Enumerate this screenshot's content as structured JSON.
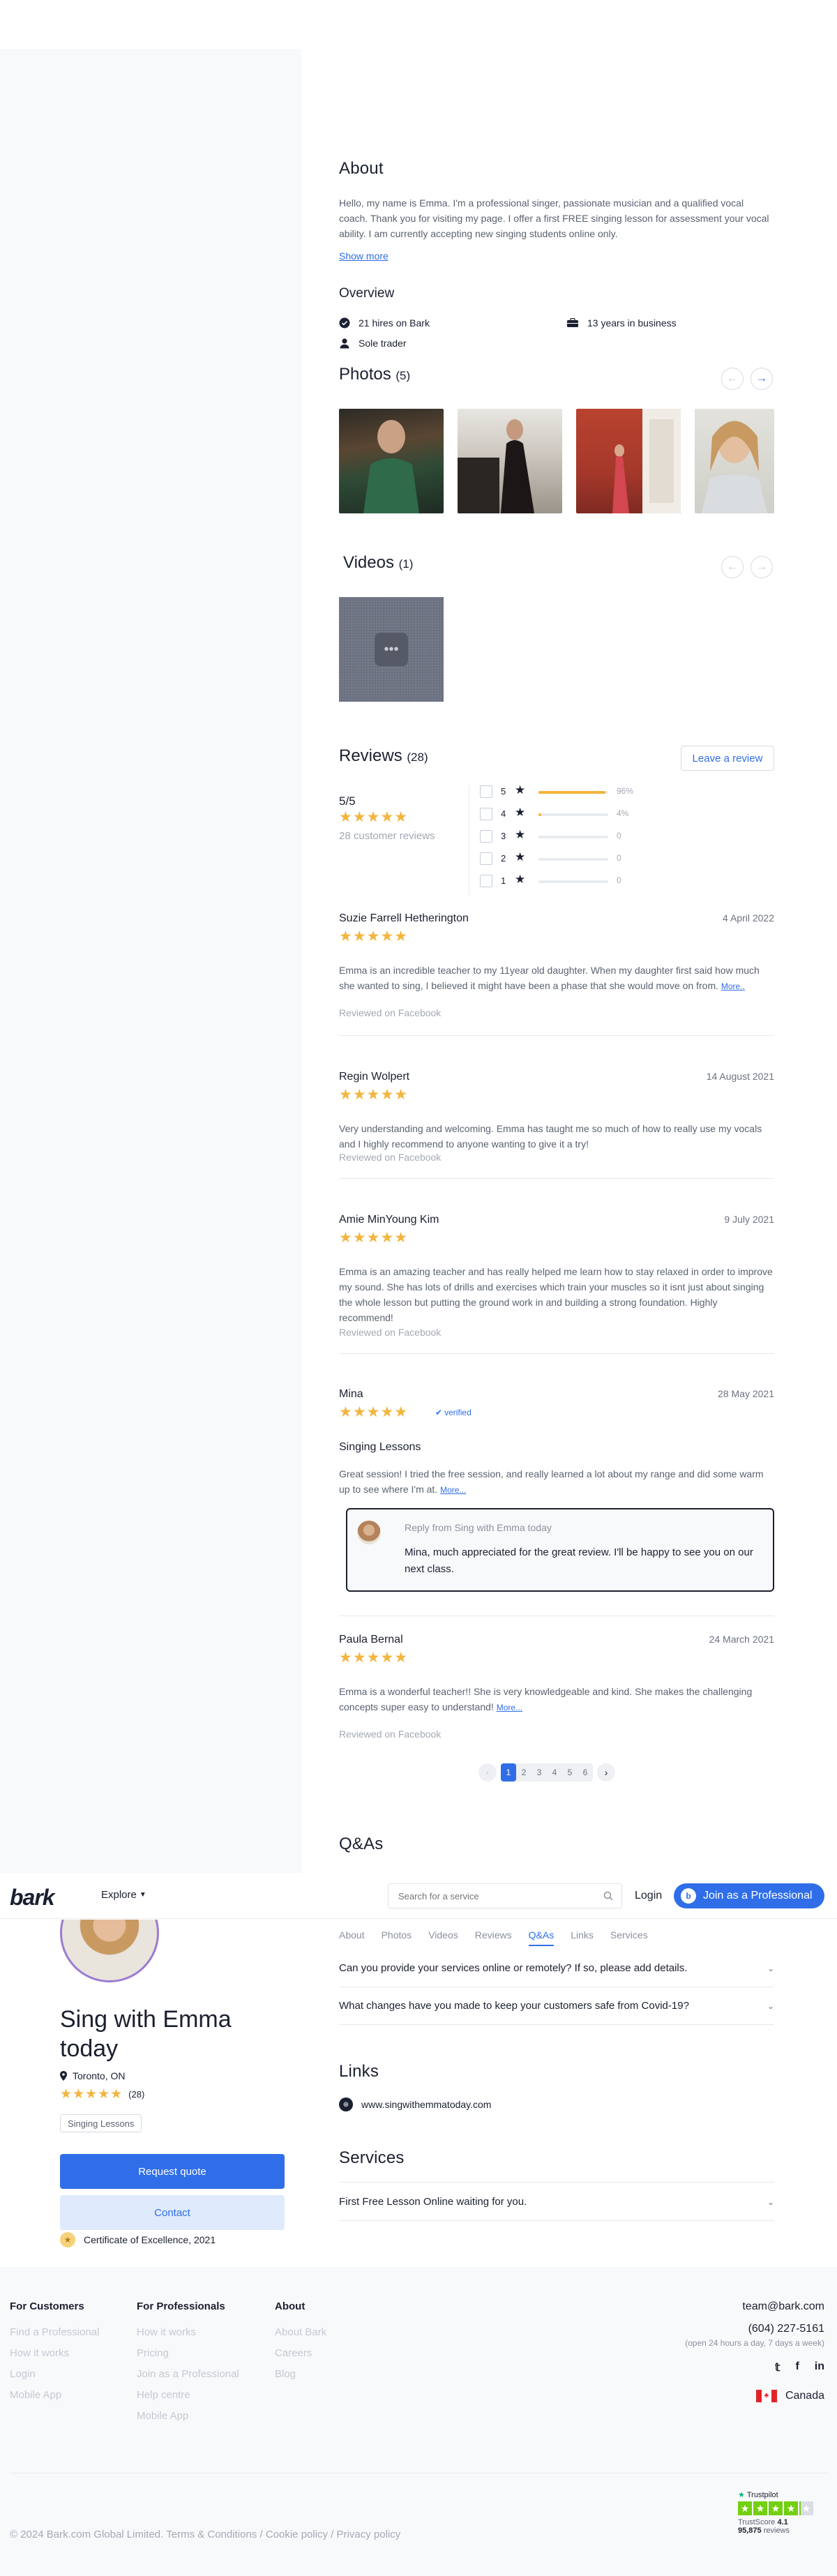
{
  "about": {
    "title": "About",
    "text": "Hello, my name is Emma. I'm a professional singer, passionate musician and a qualified vocal coach. Thank you for visiting my page. I offer a first FREE singing lesson for assessment your vocal ability. I am currently accepting new singing students online only.",
    "show_more": "Show more"
  },
  "overview": {
    "title": "Overview",
    "hires": "21 hires on Bark",
    "years": "13 years in business",
    "trader": "Sole trader"
  },
  "photos": {
    "title": "Photos",
    "count": "(5)"
  },
  "videos": {
    "title": "Videos",
    "count": "(1)"
  },
  "reviews_section": {
    "title": "Reviews",
    "count": "(28)",
    "leave_review": "Leave a review",
    "score": "5/5",
    "customer_reviews": "28 customer reviews",
    "breakdown": [
      {
        "star": "5",
        "pct": "96%",
        "fraction": 0.96
      },
      {
        "star": "4",
        "pct": "4%",
        "fraction": 0.04
      },
      {
        "star": "3",
        "pct": "0",
        "fraction": 0
      },
      {
        "star": "2",
        "pct": "0",
        "fraction": 0
      },
      {
        "star": "1",
        "pct": "0",
        "fraction": 0
      }
    ]
  },
  "reviews": [
    {
      "name": "Suzie Farrell Hetherington",
      "date": "4 April 2022",
      "text": "Emma is an incredible teacher to my 11year old daughter. When my daughter first said how much she wanted to sing, I believed it might have been a phase that she would move on from.",
      "more": "More..",
      "source": "Reviewed on Facebook"
    },
    {
      "name": "Regin Wolpert",
      "date": "14 August 2021",
      "text": "Very understanding and welcoming. Emma has taught me so much of how to really use my vocals and I highly recommend to anyone wanting to give it a try!",
      "source": "Reviewed on Facebook"
    },
    {
      "name": "Amie MinYoung Kim",
      "date": "9 July 2021",
      "text": "Emma is an amazing teacher and has really helped me learn how to stay relaxed in order to improve my sound. She has lots of drills and exercises which train your muscles so it isnt just about singing the whole lesson but putting the ground work in and building a strong foundation. Highly recommend!",
      "source": "Reviewed on Facebook"
    },
    {
      "name": "Mina",
      "date": "28 May 2021",
      "verified": "verified",
      "service": "Singing Lessons",
      "text": "Great session! I tried the free session, and really learned a lot about my range and did some warm up to see where I'm at.",
      "more": "More...",
      "reply_title": "Reply from Sing with Emma today",
      "reply_text": "Mina, much appreciated for the great review. I'll be happy to see you on our next class."
    },
    {
      "name": "Paula Bernal",
      "date": "24 March 2021",
      "text": "Emma is a wonderful teacher!! She is very knowledgeable and kind. She makes the challenging concepts super easy to understand!",
      "more": "More...",
      "source": "Reviewed on Facebook"
    }
  ],
  "pagination": {
    "pages": [
      "1",
      "2",
      "3",
      "4",
      "5",
      "6"
    ],
    "current": "1"
  },
  "qas": {
    "title": "Q&As",
    "questions": [
      "Can you provide your services online or remotely? If so, please add details.",
      "What changes have you made to keep your customers safe from Covid-19?"
    ]
  },
  "header": {
    "logo": "bark",
    "explore": "Explore",
    "search_placeholder": "Search for a service",
    "login": "Login",
    "join": "Join as a Professional"
  },
  "subnav": [
    "About",
    "Photos",
    "Videos",
    "Reviews",
    "Q&As",
    "Links",
    "Services"
  ],
  "subnav_active": "Q&As",
  "profile": {
    "name_line1": "Sing with Emma",
    "name_line2": "today",
    "location": "Toronto, ON",
    "rating_count": "(28)",
    "tag": "Singing Lessons",
    "request_quote": "Request quote",
    "contact": "Contact",
    "certificate": "Certificate of Excellence, 2021"
  },
  "links": {
    "title": "Links",
    "url": "www.singwithemmatoday.com"
  },
  "services": {
    "title": "Services",
    "item": "First Free Lesson Online waiting for you."
  },
  "footer": {
    "customers": {
      "title": "For Customers",
      "items": [
        "Find a Professional",
        "How it works",
        "Login",
        "Mobile App"
      ]
    },
    "professionals": {
      "title": "For Professionals",
      "items": [
        "How it works",
        "Pricing",
        "Join as a Professional",
        "Help centre",
        "Mobile App"
      ]
    },
    "about": {
      "title": "About",
      "items": [
        "About Bark",
        "Careers",
        "Blog"
      ]
    },
    "email": "team@bark.com",
    "phone": "(604) 227-5161",
    "hours": "(open 24 hours a day, 7 days a week)",
    "country": "Canada",
    "copyright": "© 2024 Bark.com Global Limited.",
    "terms": "Terms & Conditions",
    "cookie": "Cookie policy",
    "privacy": "Privacy policy",
    "trustpilot": "Trustpilot",
    "trustscore_label": "TrustScore",
    "trustscore": "4.1",
    "review_total": "95,875",
    "reviews_word": "reviews"
  },
  "colors": {
    "accent": "#2f6ee8",
    "star": "#f2b53e",
    "navy": "#1b2030"
  }
}
